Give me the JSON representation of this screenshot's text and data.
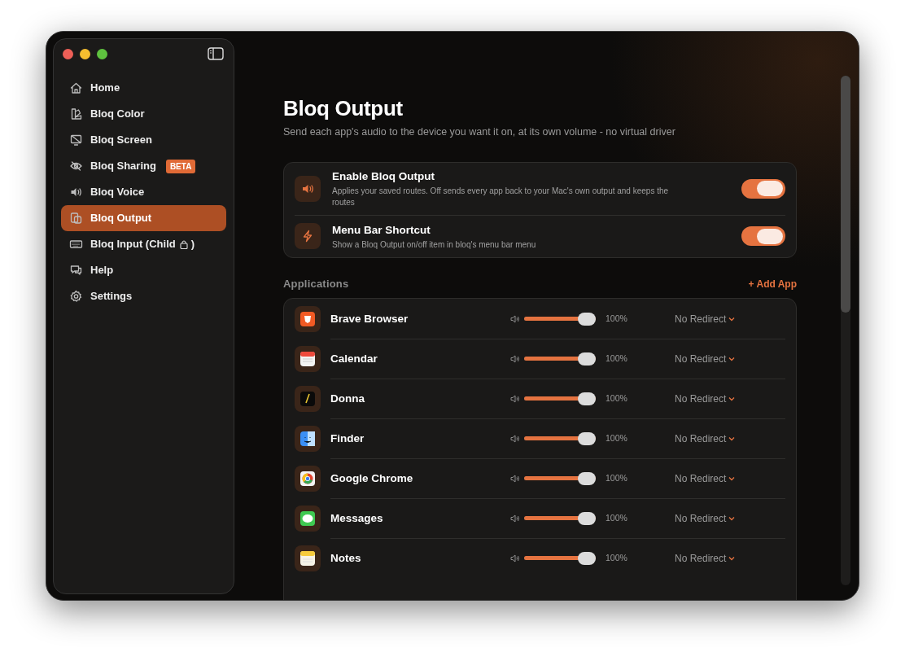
{
  "sidebar": {
    "items": [
      {
        "label": "Home",
        "selected": false
      },
      {
        "label": "Bloq Color",
        "selected": false
      },
      {
        "label": "Bloq Screen",
        "selected": false
      },
      {
        "label": "Bloq Sharing",
        "badge": "BETA",
        "selected": false
      },
      {
        "label": "Bloq Voice",
        "selected": false
      },
      {
        "label": "Bloq Output",
        "selected": true
      },
      {
        "label": "Bloq Input (Child",
        "locked": true,
        "closing": ")",
        "selected": false
      },
      {
        "label": "Help",
        "selected": false
      },
      {
        "label": "Settings",
        "selected": false
      }
    ]
  },
  "header": {
    "title": "Bloq Output",
    "subtitle": "Send each app's audio to the device you want it on, at its own volume - no virtual driver"
  },
  "settings": [
    {
      "title": "Enable Bloq Output",
      "description": "Applies your saved routes. Off sends every app back to your Mac's own output and keeps the routes",
      "on": true
    },
    {
      "title": "Menu Bar Shortcut",
      "description": "Show a Bloq Output on/off item in bloq's menu bar menu",
      "on": true
    }
  ],
  "applications": {
    "heading": "Applications",
    "add_button": "+ Add App",
    "rows": [
      {
        "name": "Brave Browser",
        "level": 1,
        "reading": "100%",
        "route": "No Redirect"
      },
      {
        "name": "Calendar",
        "level": 1,
        "reading": "100%",
        "route": "No Redirect"
      },
      {
        "name": "Donna",
        "level": 1,
        "reading": "100%",
        "route": "No Redirect"
      },
      {
        "name": "Finder",
        "level": 1,
        "reading": "100%",
        "route": "No Redirect"
      },
      {
        "name": "Google Chrome",
        "level": 1,
        "reading": "100%",
        "route": "No Redirect"
      },
      {
        "name": "Messages",
        "level": 1,
        "reading": "100%",
        "route": "No Redirect"
      },
      {
        "name": "Notes",
        "level": 1,
        "reading": "100%",
        "route": "No Redirect"
      }
    ]
  }
}
